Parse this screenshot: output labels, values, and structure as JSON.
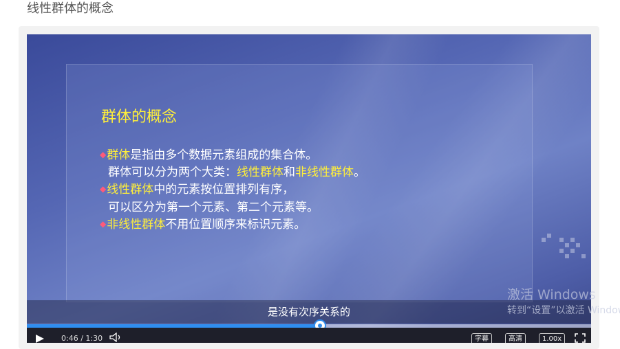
{
  "page": {
    "title": "线性群体的概念"
  },
  "slide": {
    "heading": "群体的概念",
    "bullet_1": {
      "term": "群体",
      "text": "是指由多个数据元素组成的集合体。"
    },
    "line_2": {
      "prefix": "群体可以分为两个大类：",
      "term_a": "线性群体",
      "mid": "和",
      "term_b": "非线性群体",
      "suffix": "。"
    },
    "bullet_2": {
      "term": "线性群体",
      "text": "中的元素按位置排列有序，"
    },
    "line_4": "可以区分为第一个元素、第二个元素等。",
    "bullet_3": {
      "term": "非线性群体",
      "text": "不用位置顺序来标识元素。"
    }
  },
  "player": {
    "subtitle": "是没有次序关系的",
    "time": "0:46 / 1:30",
    "progress_fraction": 0.52,
    "buttons": {
      "subtitles": "字幕",
      "quality": "高清",
      "speed": "1.00x"
    }
  },
  "watermark": {
    "line_1": "激活 Windows",
    "line_2": "转到“设置”以激活 Windows。"
  },
  "colors": {
    "highlight": "#ffef3a",
    "accent": "#2f8ef0",
    "bullet": "#ff5a7a"
  }
}
